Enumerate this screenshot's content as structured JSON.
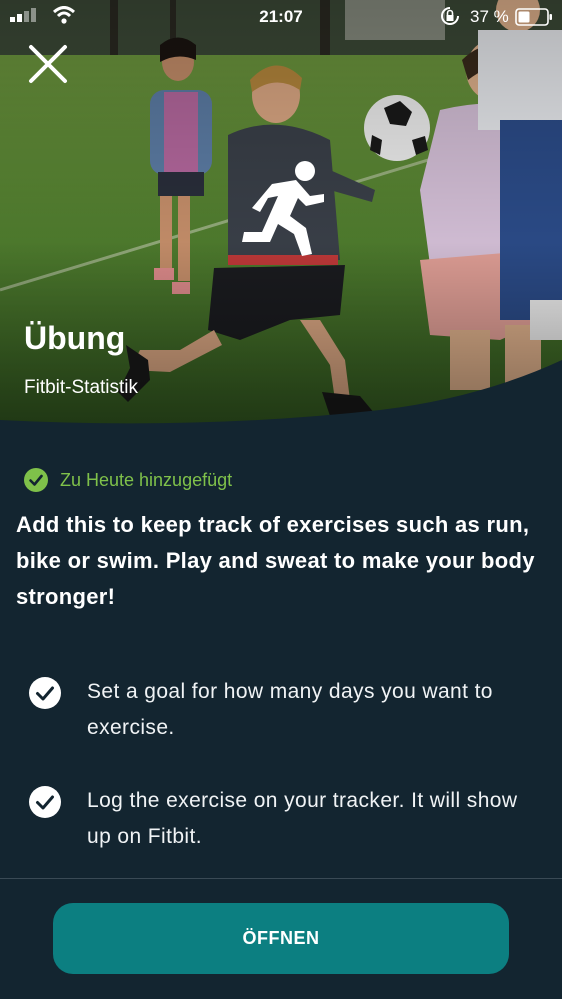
{
  "status_bar": {
    "time": "21:07",
    "battery_percent": "37 %",
    "signal_icon": "signal-bars-icon",
    "wifi_icon": "wifi-icon",
    "rotation_lock_icon": "rotation-lock-icon",
    "battery_icon": "battery-icon"
  },
  "hero": {
    "title": "Übung",
    "subtitle": "Fitbit-Statistik",
    "close_icon": "close-icon",
    "activity_icon": "running-person-icon"
  },
  "added_status": {
    "label": "Zu Heute hinzugefügt",
    "icon": "check-circle-icon",
    "color": "#7fc14a"
  },
  "description": "Add this to keep track of exercises such as run, bike or swim. Play and sweat to make your body stronger!",
  "bullets": [
    {
      "text": "Set a goal for how many days you want to exercise.",
      "icon": "check-circle-icon"
    },
    {
      "text": "Log the exercise on your tracker. It will show up on Fitbit.",
      "icon": "check-circle-icon"
    }
  ],
  "open_button": {
    "label": "ÖFFNEN",
    "color": "#0c7f81"
  },
  "colors": {
    "background": "#132530",
    "accent_green": "#7fc14a"
  }
}
